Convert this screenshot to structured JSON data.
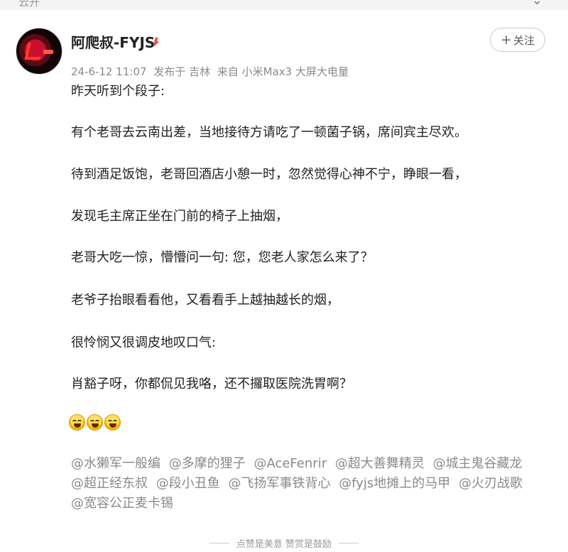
{
  "top": {
    "label": "云开"
  },
  "post": {
    "username": "阿爬叔-FYJS",
    "meta": {
      "date": "24-6-12 11:07",
      "location": "发布于 吉林",
      "device": "来自 小米Max3 大屏大电量"
    },
    "follow_label": "关注",
    "lines": [
      "昨天听到个段子:",
      "有个老哥去云南出差，当地接待方请吃了一顿菌子锅，席间宾主尽欢。",
      "待到酒足饭饱，老哥回酒店小憩一时，忽然觉得心神不宁，睁眼一看，",
      "发现毛主席正坐在门前的椅子上抽烟，",
      "老哥大吃一惊，懵懵问一句: 您，您老人家怎么来了？",
      "老爷子抬眼看看他，又看看手上越抽越长的烟，",
      "很怜悯又很调皮地叹口气:",
      "肖豁子呀，你都侃见我咯，还不攞取医院洗胃啊？"
    ],
    "mentions": [
      "@水獭军一般编",
      "@多摩的狸子",
      "@AceFenrir",
      "@超大善舞精灵",
      "@城主鬼谷藏龙",
      "@超正经东叔",
      "@段小丑鱼",
      "@飞扬军事铁背心",
      "@fyjs地摊上的马甲",
      "@火刃战歌",
      "@宽容公正麦卡锡"
    ]
  },
  "footer": {
    "text": "点赞是美意   赞赏是鼓励"
  }
}
